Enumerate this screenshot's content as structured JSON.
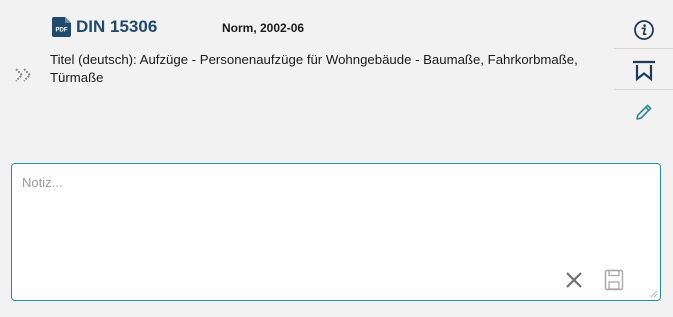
{
  "document": {
    "number": "DIN 15306",
    "type_date": "Norm, 2002-06",
    "title": "Titel (deutsch): Aufzüge - Personenaufzüge für Wohngebäude - Baumaße, Fahrkorbmaße, Türmaße",
    "file_icon": "pdf-icon",
    "file_icon_text": "PDF"
  },
  "side_actions": [
    {
      "icon": "info-icon"
    },
    {
      "icon": "bookmark-icon"
    },
    {
      "icon": "pencil-icon"
    }
  ],
  "note": {
    "placeholder": "Notiz...",
    "value": "",
    "clear_icon": "close-icon",
    "save_icon": "save-icon"
  },
  "colors": {
    "brand_dark": "#1f4a6e",
    "accent_teal": "#2b8a97",
    "background": "#f2f2f2"
  }
}
